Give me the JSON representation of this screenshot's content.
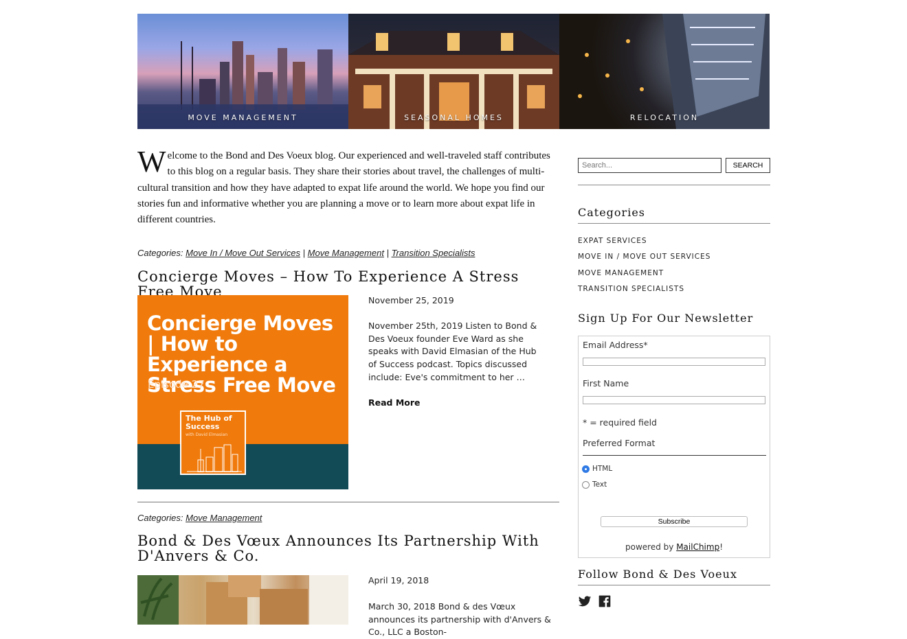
{
  "hero": {
    "panels": [
      {
        "label": "MOVE MANAGEMENT"
      },
      {
        "label": "SEASONAL HOMES"
      },
      {
        "label": "RELOCATION"
      }
    ]
  },
  "intro": {
    "dropcap": "W",
    "text": "elcome to the Bond and Des Voeux blog. Our experienced and well-traveled staff contributes to this blog on a regular basis. They share their stories about travel, the challenges of multi-cultural transition and how they have adapted to expat life around the world. We hope you find our stories fun and informative whether you are planning a move or to learn more about expat life in different countries."
  },
  "posts": [
    {
      "categories_label": "Categories:",
      "categories": [
        "Move In / Move Out Services",
        "Move Management",
        "Transition Specialists"
      ],
      "separator": "|",
      "title": "Concierge Moves – How To Experience A Stress Free Move",
      "date": "November 25, 2019",
      "excerpt": "November 25th, 2019 Listen to Bond & Des Voeux founder Eve Ward as she speaks with David Elmasian of the Hub of Success podcast. Topics discussed include: Eve's commitment to her …",
      "read_more": "Read More",
      "thumb": {
        "headline": "Concierge Moves | How to Experience a Stress Free Move",
        "episode": "Episode 27",
        "badge_title": "The Hub of Success",
        "badge_sub": "with David Elmasian",
        "bg_color": "#f07a0b",
        "band_color": "#124a56"
      }
    },
    {
      "categories_label": "Categories:",
      "categories": [
        "Move Management"
      ],
      "title": "Bond & Des Vœux Announces Its Partnership With D'Anvers & Co.",
      "date": "April 19, 2018",
      "excerpt": "March 30, 2018 Bond & des Vœux announces its partnership with d'Anvers & Co., LLC a Boston-"
    }
  ],
  "sidebar": {
    "search": {
      "placeholder": "Search...",
      "button": "SEARCH"
    },
    "categories_heading": "Categories",
    "categories": [
      "EXPAT SERVICES",
      "MOVE IN / MOVE OUT SERVICES",
      "MOVE MANAGEMENT",
      "TRANSITION SPECIALISTS"
    ],
    "newsletter": {
      "heading": "Sign Up For Our Newsletter",
      "email_label": "Email Address*",
      "first_name_label": "First Name",
      "required_note": "* = required field",
      "format_label": "Preferred Format",
      "format_options": [
        "HTML",
        "Text"
      ],
      "format_selected": "HTML",
      "subscribe": "Subscribe",
      "powered_prefix": "powered by ",
      "powered_link": "MailChimp",
      "powered_suffix": "!"
    },
    "follow_heading": "Follow Bond & Des Voeux",
    "social": [
      "twitter-icon",
      "facebook-icon"
    ]
  },
  "colors": {
    "accent_radio": "#2f7ae5"
  }
}
